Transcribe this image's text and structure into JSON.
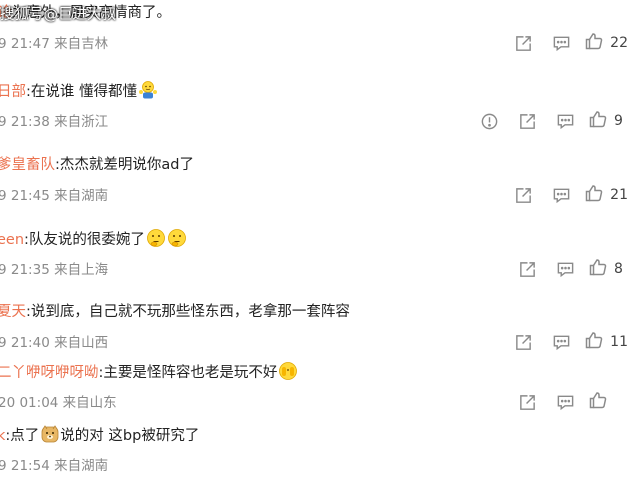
{
  "watermark": "搜狐号@巨进大叔",
  "comments": [
    {
      "user": "论",
      "colon": "",
      "text": "为意外，属实高情商了。",
      "emojis": [],
      "time": "9 21:47",
      "location": "来自吉林",
      "show_report": false,
      "likes": "22"
    },
    {
      "user": "日部",
      "colon": ":",
      "text": "在说谁 懂得都懂",
      "emojis": [
        "shrug-emoji-icon"
      ],
      "time": "9 21:38",
      "location": "来自浙江",
      "show_report": true,
      "likes": "9"
    },
    {
      "user": "爹皇畜队",
      "colon": ":",
      "text": "杰杰就差明说你ad了",
      "emojis": [],
      "time": "9 21:45",
      "location": "来自湖南",
      "show_report": false,
      "likes": "21"
    },
    {
      "user": "een",
      "colon": ":",
      "text": "队友说的很委婉了",
      "emojis": [
        "thinking-emoji-icon",
        "thinking-emoji-icon"
      ],
      "time": "9 21:35",
      "location": "来自上海",
      "show_report": false,
      "likes": "8"
    },
    {
      "user": "夏天",
      "colon": ":",
      "text": "说到底，自己就不玩那些怪东西，老拿那一套阵容",
      "emojis": [],
      "time": "9 21:40",
      "location": "来自山西",
      "show_report": false,
      "likes": "11"
    },
    {
      "user": "二丫咿呀咿呀呦",
      "colon": ":",
      "text": "主要是怪阵容也老是玩不好",
      "emojis": [
        "peek-emoji-icon"
      ],
      "time": "20 01:04",
      "location": "来自山东",
      "show_report": false,
      "likes": ""
    },
    {
      "user": "k",
      "colon": ":",
      "text": "点了",
      "emojis": [
        "doge-emoji-icon"
      ],
      "text_after": "说的对 这bp被研究了",
      "time": "9 21:54",
      "location": "来自湖南",
      "show_report": false,
      "likes": ""
    }
  ],
  "colors": {
    "username": "#eb7350",
    "meta": "#8a8a8a",
    "icon": "#8a8a8a"
  }
}
